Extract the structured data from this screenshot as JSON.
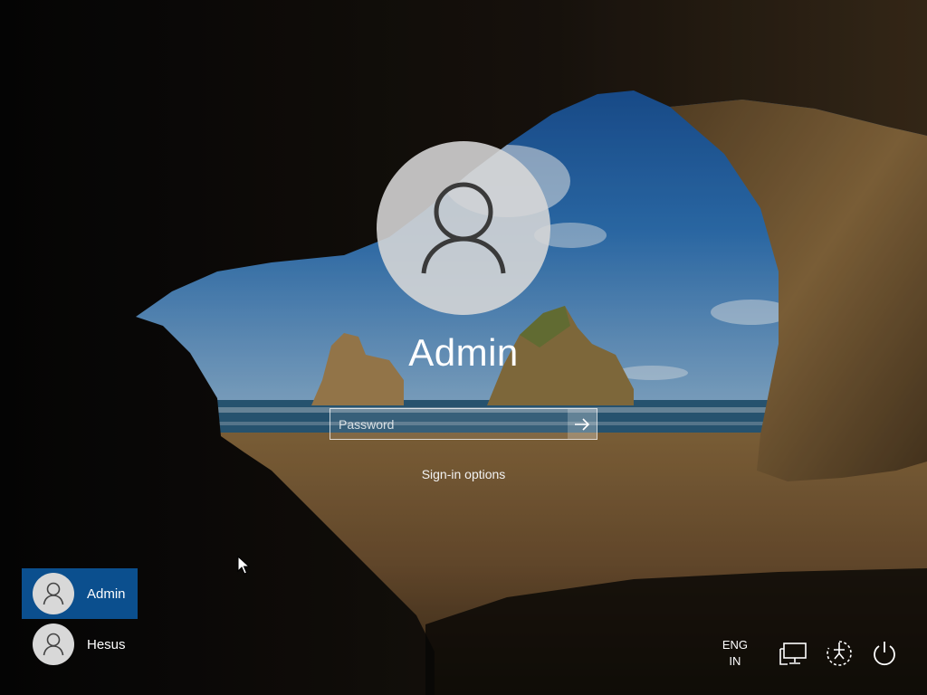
{
  "login": {
    "username": "Admin",
    "password_placeholder": "Password",
    "signin_options_label": "Sign-in options"
  },
  "users": [
    {
      "name": "Admin",
      "selected": true
    },
    {
      "name": "Hesus",
      "selected": false
    }
  ],
  "tray": {
    "language_line1": "ENG",
    "language_line2": "IN"
  },
  "colors": {
    "selected_tile": "#0b4f8e",
    "avatar_circle": "#d8d8d8"
  },
  "icons": {
    "avatar": "person-icon",
    "submit": "arrow-right-icon",
    "network": "network-icon",
    "accessibility": "ease-of-access-icon",
    "power": "power-icon"
  }
}
